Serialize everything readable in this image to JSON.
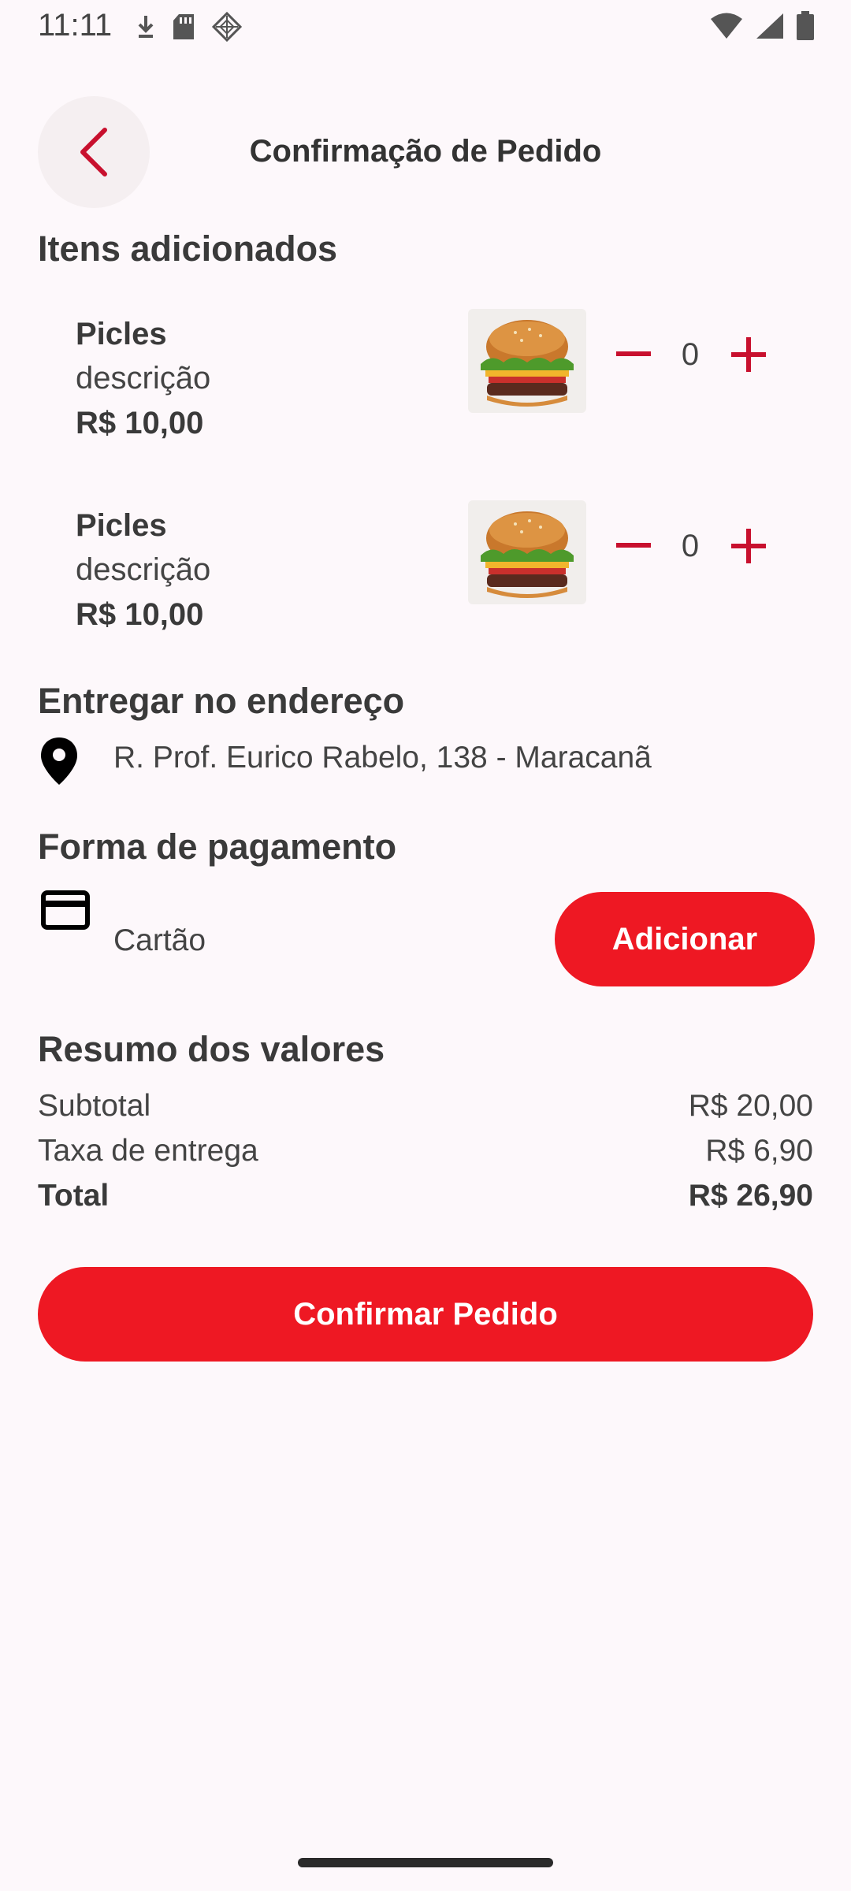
{
  "status_bar": {
    "time": "11:11",
    "left_icons": [
      "download-icon",
      "sd-card-icon",
      "sync-icon"
    ],
    "right_icons": [
      "wifi-icon",
      "signal-icon",
      "battery-icon"
    ]
  },
  "header": {
    "back_icon": "chevron-left-icon",
    "title": "Confirmação de Pedido"
  },
  "items_section": {
    "title": "Itens adicionados",
    "items": [
      {
        "name": "Picles",
        "description": "descrição",
        "price": "R$ 10,00",
        "quantity": "0",
        "image": "burger-image"
      },
      {
        "name": "Picles",
        "description": "descrição",
        "price": "R$ 10,00",
        "quantity": "0",
        "image": "burger-image"
      }
    ]
  },
  "delivery": {
    "title": "Entregar no endereço",
    "icon": "location-pin-icon",
    "address": "R. Prof. Eurico Rabelo, 138 - Maracanã"
  },
  "payment": {
    "title": "Forma de pagamento",
    "icon": "credit-card-icon",
    "method": "Cartão",
    "add_label": "Adicionar"
  },
  "summary": {
    "title": "Resumo dos valores",
    "subtotal_label": "Subtotal",
    "subtotal_value": "R$ 20,00",
    "delivery_fee_label": "Taxa de entrega",
    "delivery_fee_value": "R$ 6,90",
    "total_label": "Total",
    "total_value": "R$ 26,90"
  },
  "confirm_label": "Confirmar Pedido",
  "colors": {
    "accent": "#ee1823",
    "back_icon": "#c8102e",
    "background": "#fdf8fb",
    "text": "#3a3a3a"
  }
}
